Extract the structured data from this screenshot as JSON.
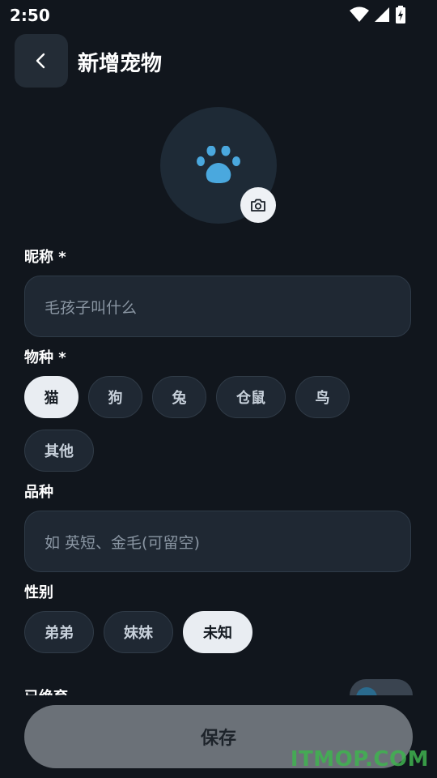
{
  "status_bar": {
    "time": "2:50"
  },
  "header": {
    "title": "新增宠物"
  },
  "form": {
    "nickname": {
      "label": "昵称 *",
      "placeholder": "毛孩子叫什么"
    },
    "species": {
      "label": "物种 *",
      "options": [
        "猫",
        "狗",
        "兔",
        "仓鼠",
        "鸟",
        "其他"
      ],
      "selected": "猫"
    },
    "breed": {
      "label": "品种",
      "placeholder": "如 英短、金毛(可留空)"
    },
    "gender": {
      "label": "性别",
      "options": [
        "弟弟",
        "妹妹",
        "未知"
      ],
      "selected": "未知"
    },
    "next_section_label": "已绝育"
  },
  "save_button": {
    "label": "保存"
  },
  "watermark": "ITMOP.COM",
  "colors": {
    "accent_paw": "#4aa8de",
    "selected_chip": "#e9edf2",
    "background": "#11161d"
  }
}
